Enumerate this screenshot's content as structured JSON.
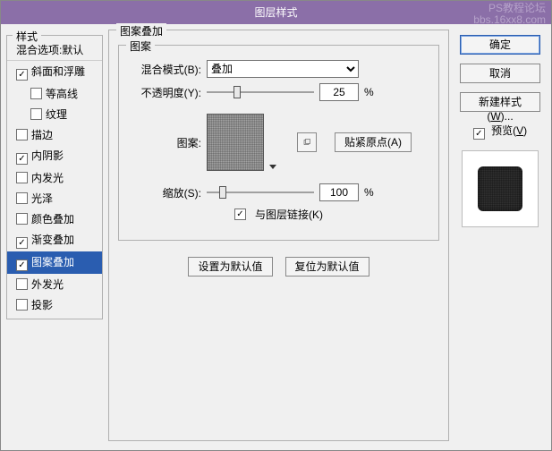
{
  "title": "图层样式",
  "watermark": {
    "l1": "PS教程论坛",
    "l2": "bbs.16xx8.com"
  },
  "left": {
    "legend": "样式",
    "header": "混合选项:默认",
    "items": [
      {
        "label": "斜面和浮雕",
        "checked": true,
        "indent": false
      },
      {
        "label": "等高线",
        "checked": false,
        "indent": true
      },
      {
        "label": "纹理",
        "checked": false,
        "indent": true
      },
      {
        "label": "描边",
        "checked": false,
        "indent": false
      },
      {
        "label": "内阴影",
        "checked": true,
        "indent": false
      },
      {
        "label": "内发光",
        "checked": false,
        "indent": false
      },
      {
        "label": "光泽",
        "checked": false,
        "indent": false
      },
      {
        "label": "颜色叠加",
        "checked": false,
        "indent": false
      },
      {
        "label": "渐变叠加",
        "checked": true,
        "indent": false
      },
      {
        "label": "图案叠加",
        "checked": true,
        "indent": false,
        "selected": true
      },
      {
        "label": "外发光",
        "checked": false,
        "indent": false
      },
      {
        "label": "投影",
        "checked": false,
        "indent": false
      }
    ]
  },
  "mid": {
    "legend": "图案叠加",
    "inner_legend": "图案",
    "blend_label": "混合模式(B):",
    "blend_value": "叠加",
    "opacity_label": "不透明度(Y):",
    "opacity_value": "25",
    "pct": "%",
    "pattern_label": "图案:",
    "snap_label": "贴紧原点(A)",
    "scale_label": "缩放(S):",
    "scale_value": "100",
    "link_label": "与图层链接(K)",
    "default_btn": "设置为默认值",
    "reset_btn": "复位为默认值"
  },
  "right": {
    "ok": "确定",
    "cancel": "取消",
    "newstyle": "新建样式(W)...",
    "preview_label": "预览(V)"
  }
}
